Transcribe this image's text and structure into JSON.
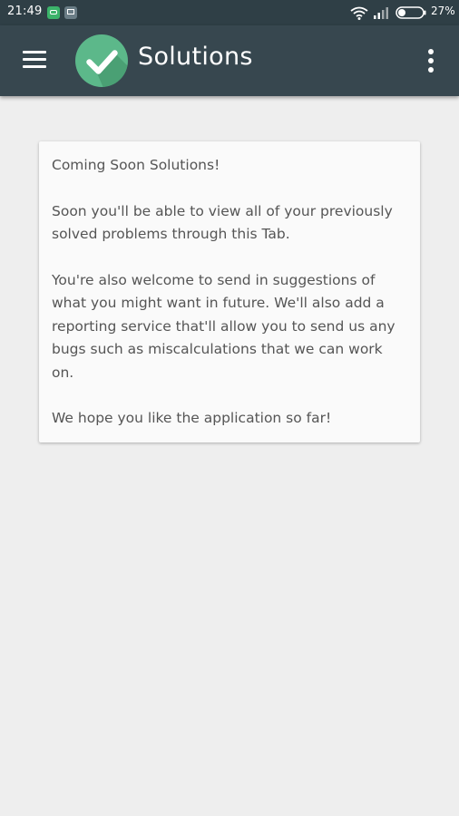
{
  "status_bar": {
    "time": "21:49",
    "battery_percent": "27%",
    "battery_level": 0.27,
    "icons": [
      "chat-notification-icon",
      "screen-notification-icon",
      "wifi-icon",
      "cell-signal-icon",
      "battery-icon"
    ]
  },
  "app_bar": {
    "title": "Solutions",
    "menu_icon": "hamburger-menu-icon",
    "logo_icon": "checkmark-logo-icon",
    "overflow_icon": "more-vertical-icon",
    "color": "#37474f",
    "logo_color": "#5cb88a"
  },
  "card": {
    "paragraphs": [
      "Coming Soon Solutions!",
      "Soon you'll be able to view all of your previously solved problems through this Tab.",
      "You're also welcome to send in suggestions of what you might want in future. We'll also add a reporting service that'll allow you to send us any bugs such as miscalculations that we can work on.",
      "We hope you like the application so far!"
    ]
  },
  "colors": {
    "status_bar": "#2f3f46",
    "app_bar": "#37474f",
    "background": "#eeeeee",
    "card": "#fafafa",
    "text": "#555555"
  }
}
